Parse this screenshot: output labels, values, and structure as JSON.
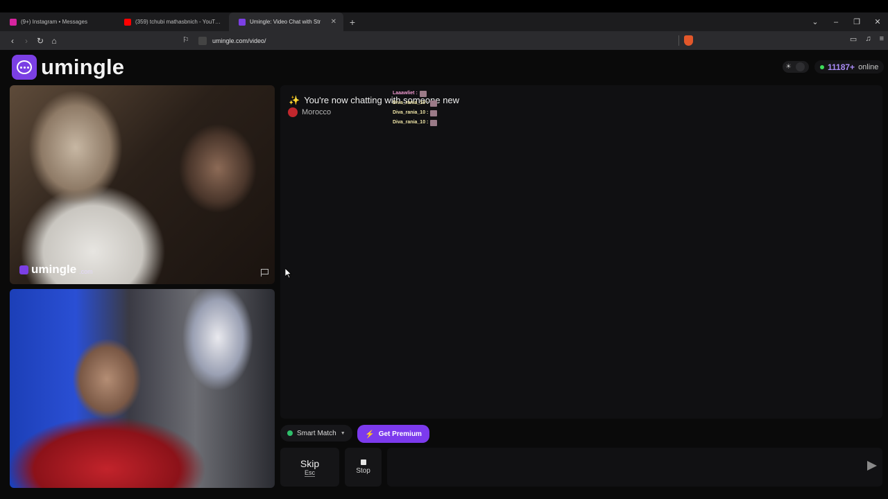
{
  "browser": {
    "tabs": [
      {
        "title": "(9+) Instagram • Messages",
        "icon": "instagram-icon",
        "color": "#d6249f"
      },
      {
        "title": "(359) tchubi mathasbnich - YouTube",
        "icon": "youtube-icon",
        "color": "#ff0000"
      },
      {
        "title": "Umingle: Video Chat with Str",
        "icon": "umingle-icon",
        "color": "#7b3fe4"
      }
    ],
    "new_tab": "+",
    "url": "umingle.com/video/"
  },
  "app": {
    "logo_text": "umingle",
    "online_count": "11187+",
    "online_label": "online",
    "accent": "#7c3aed"
  },
  "video": {
    "watermark": "umingle",
    "watermark_domain": ".com"
  },
  "chat": {
    "notice": "You're now chatting with someone new",
    "country": "Morocco",
    "overlay_rows": [
      {
        "user": "Laaawliet :"
      },
      {
        "user": "Diva_rania_10 :"
      },
      {
        "user": "Diva_rania_10 :"
      },
      {
        "user": "Diva_rania_10 :"
      }
    ]
  },
  "controls": {
    "smart_match": "Smart Match",
    "premium": "Get Premium",
    "skip": "Skip",
    "skip_key": "Esc",
    "stop": "Stop",
    "message_placeholder": ""
  }
}
